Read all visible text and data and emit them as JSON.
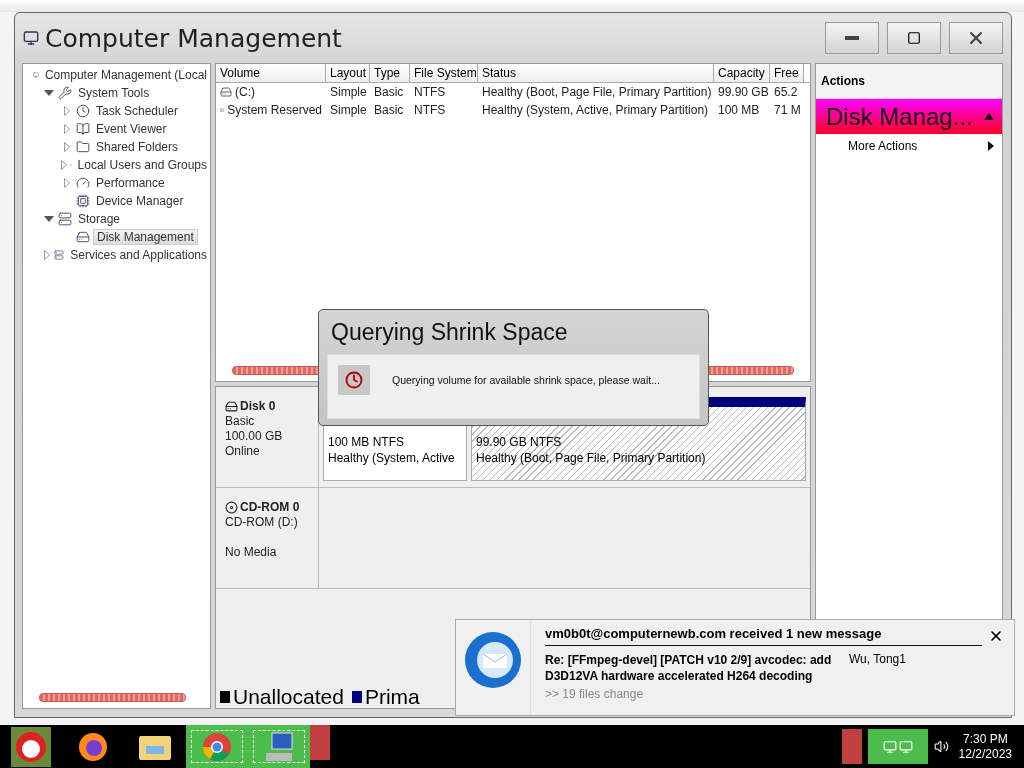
{
  "window": {
    "title": "Computer Management"
  },
  "tree": [
    {
      "label": "Computer Management (Local",
      "selected": false,
      "children": [
        {
          "label": "System Tools",
          "expanded": true,
          "selected": false,
          "children": [
            {
              "label": "Task Scheduler",
              "expanded": false,
              "selected": false
            },
            {
              "label": "Event Viewer",
              "expanded": false,
              "selected": false
            },
            {
              "label": "Shared Folders",
              "expanded": false,
              "selected": false
            },
            {
              "label": "Local Users and Groups",
              "expanded": false,
              "selected": false
            },
            {
              "label": "Performance",
              "expanded": false,
              "selected": false
            },
            {
              "label": "Device Manager",
              "selected": false
            }
          ]
        },
        {
          "label": "Storage",
          "expanded": true,
          "selected": false,
          "children": [
            {
              "label": "Disk Management",
              "selected": true
            }
          ]
        },
        {
          "label": "Services and Applications",
          "expanded": false,
          "selected": false
        }
      ]
    }
  ],
  "table": {
    "columns": [
      "Volume",
      "Layout",
      "Type",
      "File System",
      "Status",
      "Capacity",
      "Free"
    ],
    "rows": [
      {
        "cells": [
          "(C:)",
          "Simple",
          "Basic",
          "NTFS",
          "Healthy (Boot, Page File, Primary Partition)",
          "99.90 GB",
          "65.2"
        ]
      },
      {
        "cells": [
          "System Reserved",
          "Simple",
          "Basic",
          "NTFS",
          "Healthy (System, Active, Primary Partition)",
          "100 MB",
          "71 M"
        ]
      }
    ]
  },
  "disks": [
    {
      "name": "Disk 0",
      "kind": "disk",
      "type": "Basic",
      "size": "100.00 GB",
      "status": "Online",
      "partitions": [
        {
          "lines": [
            "100 MB NTFS",
            "Healthy (System, Active"
          ],
          "selected": false
        },
        {
          "lines": [
            "99.90 GB NTFS",
            "Healthy (Boot, Page File, Primary Partition)"
          ],
          "selected": true
        }
      ]
    },
    {
      "name": "CD-ROM 0",
      "kind": "cdrom",
      "type": "CD-ROM (D:)",
      "status": "No Media"
    }
  ],
  "legend": [
    {
      "label": "Unallocated",
      "color": "#000000"
    },
    {
      "label": "Prima",
      "color": "#000080"
    }
  ],
  "actions": {
    "header": "Actions",
    "section": {
      "title": "Disk Manag...",
      "expanded": true
    },
    "items": [
      "More Actions"
    ]
  },
  "dialog": {
    "title": "Querying Shrink Space",
    "message": "Querying volume for available shrink space, please wait..."
  },
  "notification": {
    "header": "vm0b0t@computernewb.com received 1 new message",
    "subject": "Re: [FFmpeg-devel] [PATCH v10 2/9] avcodec: add D3D12VA hardware accelerated H264 decoding",
    "sender": "Wu, Tong1",
    "preview": ">> 19 files change"
  },
  "taskbar": {
    "apps": [
      {
        "highlighted": false
      },
      {
        "highlighted": false
      },
      {
        "highlighted": false
      },
      {
        "highlighted": true
      },
      {
        "highlighted": true
      }
    ],
    "time": "7:30 PM",
    "date": "12/2/2023"
  }
}
